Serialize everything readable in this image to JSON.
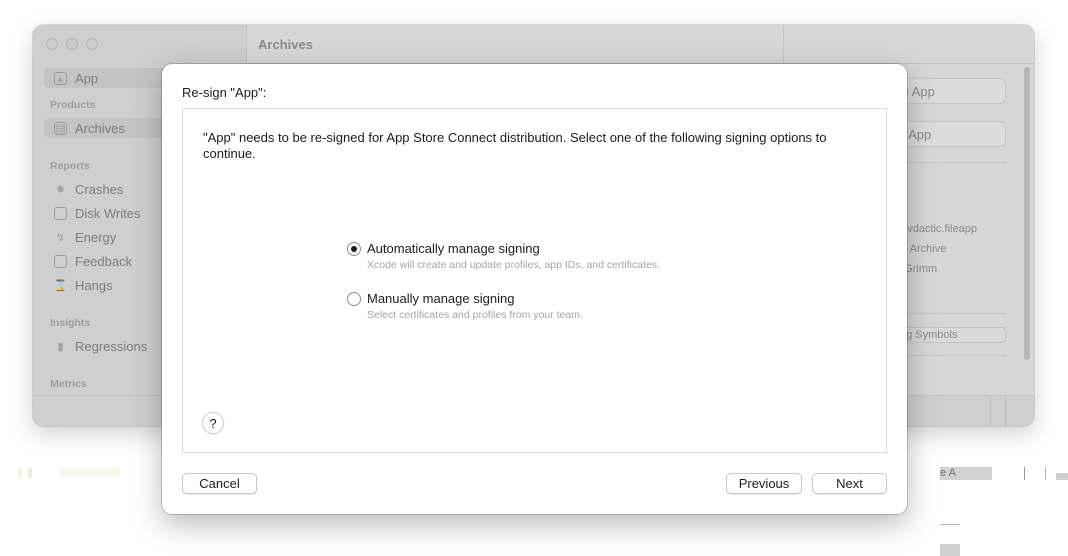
{
  "background_window": {
    "title": "Archives",
    "sidebar": {
      "top_item": "App",
      "sections": [
        {
          "header": "Products",
          "items": [
            "Archives"
          ]
        },
        {
          "header": "Reports",
          "items": [
            "Crashes",
            "Disk Writes",
            "Energy",
            "Feedback",
            "Hangs"
          ]
        },
        {
          "header": "Insights",
          "items": [
            "Regressions"
          ]
        },
        {
          "header": "Metrics",
          "items": []
        }
      ]
    },
    "right_panel": {
      "button1": "te App",
      "button2": "e App",
      "detail_lines": [
        ")",
        "devdactic.fileapp",
        "pp Archive",
        "n Grimm",
        "4"
      ],
      "small_button": "ug Symbols"
    }
  },
  "outside_fragment": "e A",
  "sheet": {
    "title": "Re-sign \"App\":",
    "description": "\"App\" needs to be re-signed for App Store Connect distribution. Select one of the following signing options to continue.",
    "options": [
      {
        "label": "Automatically manage signing",
        "sub": "Xcode will create and update profiles, app IDs, and certificates.",
        "selected": true
      },
      {
        "label": "Manually manage signing",
        "sub": "Select certificates and profiles from your team.",
        "selected": false
      }
    ],
    "help": "?",
    "cancel": "Cancel",
    "previous": "Previous",
    "next": "Next"
  }
}
